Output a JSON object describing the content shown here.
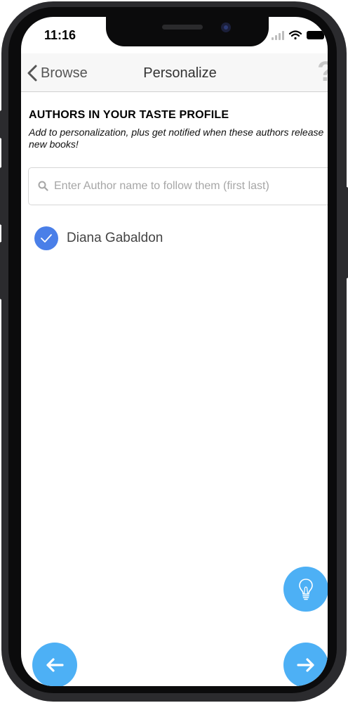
{
  "status_bar": {
    "time": "11:16"
  },
  "nav": {
    "back_label": "Browse",
    "title": "Personalize",
    "help_glyph": "?"
  },
  "section": {
    "title": "AUTHORS IN YOUR TASTE PROFILE",
    "subtitle": "Add to personalization, plus get notified when these authors release new books!"
  },
  "search": {
    "placeholder": "Enter Author name to follow them (first last)",
    "value": ""
  },
  "authors": [
    {
      "name": "Diana Gabaldon",
      "followed": true
    }
  ],
  "colors": {
    "accent_blue": "#4db0f5",
    "check_blue": "#4a7fe8"
  },
  "icons": {
    "tip": "lightbulb-icon",
    "prev": "arrow-left-icon",
    "next": "arrow-right-icon"
  }
}
